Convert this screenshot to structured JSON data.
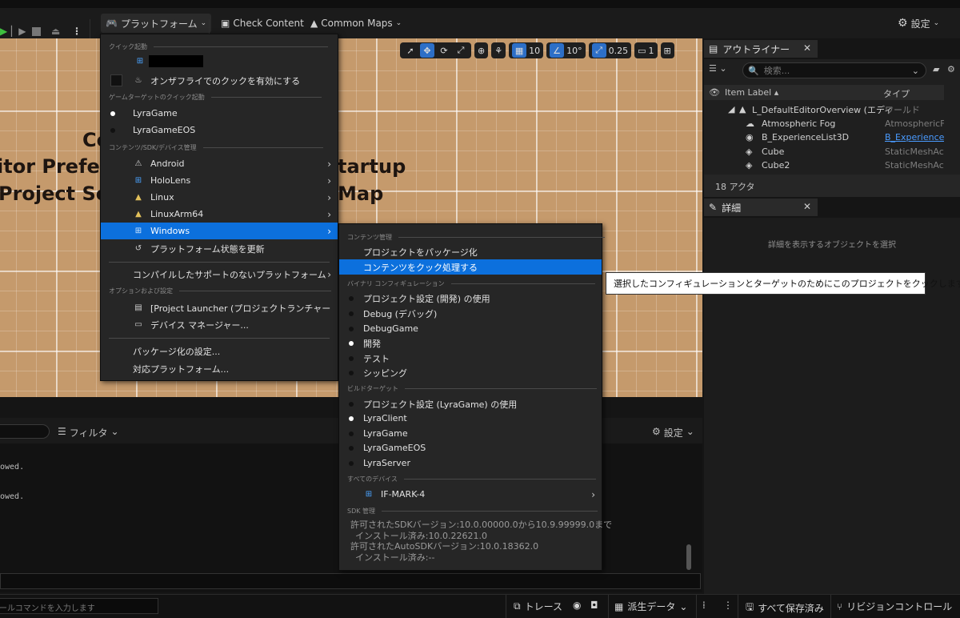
{
  "toolbar": {
    "platforms_label": "プラットフォーム",
    "check_content_label": "Check Content",
    "common_maps_label": "Common Maps",
    "settings_label": "設定"
  },
  "viewport": {
    "text_lines": [
      "Co",
      "itor Prefer",
      "Project Se",
      "tartup",
      "Map"
    ],
    "grid_snap_value": "10",
    "rotation_snap_value": "10°",
    "scale_snap_value": "0.25",
    "camera_speed_value": "1"
  },
  "outliner": {
    "tab_label": "アウトライナー",
    "search_placeholder": "検索...",
    "col_label": "Item Label ▴",
    "col_type": "タイプ",
    "rows": [
      {
        "label": "L_DefaultEditorOverview (エディ",
        "type": "ワールド"
      },
      {
        "label": "Atmospheric Fog",
        "type": "AtmosphericFc"
      },
      {
        "label": "B_ExperienceList3D",
        "type": "B_ExperienceL"
      },
      {
        "label": "Cube",
        "type": "StaticMeshAct"
      },
      {
        "label": "Cube2",
        "type": "StaticMeshAct"
      }
    ],
    "actor_count": "18 アクタ"
  },
  "details": {
    "tab_label": "詳細",
    "empty_message": "詳細を表示するオブジェクトを選択"
  },
  "output": {
    "filter_label": "フィルタ",
    "settings_label": "設定",
    "log_lines": [
      "owed.",
      "owed."
    ],
    "console_placeholder": "ールコマンドを入力します"
  },
  "statusbar": {
    "trace_label": "トレース",
    "derived_data_label": "派生データ",
    "save_all_label": "すべて保存済み",
    "revision_control_label": "リビジョンコントロール"
  },
  "platform_menu": {
    "section_quick_launch": "クイック起動",
    "on_the_fly_label": "オンザフライでのクックを有効にする",
    "section_game_target": "ゲームターゲットのクイック起動",
    "game_targets": [
      {
        "label": "LyraGame",
        "selected": true
      },
      {
        "label": "LyraGameEOS",
        "selected": false
      }
    ],
    "section_content_sdk": "コンテンツ/SDK/デバイス管理",
    "platforms": [
      "Android",
      "HoloLens",
      "Linux",
      "LinuxArm64",
      "Windows"
    ],
    "refresh_label": "プラットフォーム状態を更新",
    "unsupported_label": "コンパイルしたサポートのないプラットフォーム",
    "section_options": "オプションおよび設定",
    "project_launcher_label": "[Project Launcher (プロジェクトランチャー)]...",
    "device_manager_label": "デバイス マネージャー...",
    "packaging_settings_label": "パッケージ化の設定...",
    "supported_platforms_label": "対応プラットフォーム..."
  },
  "windows_menu": {
    "section_content": "コンテンツ管理",
    "package_project_label": "プロジェクトをパッケージ化",
    "cook_content_label": "コンテンツをクック処理する",
    "section_binary_config": "バイナリ コンフィギュレーション",
    "configs": [
      {
        "label": "プロジェクト設定 (開発) の使用",
        "selected": false
      },
      {
        "label": "Debug (デバッグ)",
        "selected": false
      },
      {
        "label": "DebugGame",
        "selected": false
      },
      {
        "label": "開発",
        "selected": true
      },
      {
        "label": "テスト",
        "selected": false
      },
      {
        "label": "シッピング",
        "selected": false
      }
    ],
    "section_build_target": "ビルドターゲット",
    "targets": [
      {
        "label": "プロジェクト設定 (LyraGame) の使用",
        "selected": false
      },
      {
        "label": "LyraClient",
        "selected": true
      },
      {
        "label": "LyraGame",
        "selected": false
      },
      {
        "label": "LyraGameEOS",
        "selected": false
      },
      {
        "label": "LyraServer",
        "selected": false
      }
    ],
    "section_all_devices": "すべてのデバイス",
    "device_label": "IF-MARK-4",
    "section_sdk": "SDK 管理",
    "sdk_lines": [
      "許可されたSDKバージョン:10.0.00000.0から10.9.99999.0まで",
      "インストール済み:10.0.22621.0",
      "許可されたAutoSDKバージョン:10.0.18362.0",
      "インストール済み:--"
    ]
  },
  "tooltip": {
    "text": "選択したコンフィギュレーションとターゲットのためにこのプロジェクトをクックします"
  }
}
